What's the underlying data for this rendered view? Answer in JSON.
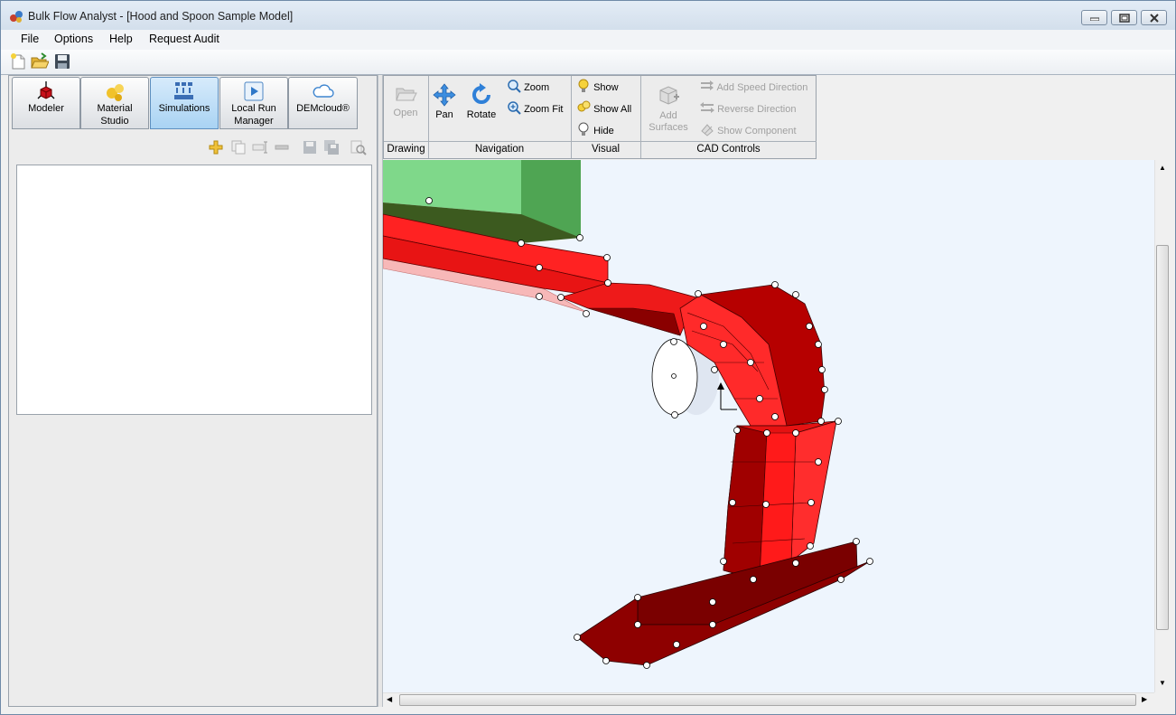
{
  "window": {
    "title": "Bulk Flow Analyst - [Hood and Spoon Sample Model]"
  },
  "menu": [
    "File",
    "Options",
    "Help",
    "Request Audit"
  ],
  "toolbar": {
    "icons": [
      "new-file-icon",
      "open-folder-icon",
      "save-icon"
    ]
  },
  "module_tabs": [
    {
      "label": "Modeler",
      "icon": "modeler-icon"
    },
    {
      "label": "Material Studio",
      "line1": "Material",
      "line2": "Studio",
      "icon": "material-icon"
    },
    {
      "label": "Simulations",
      "icon": "simulations-icon",
      "active": true
    },
    {
      "label": "Local Run Manager",
      "line1": "Local Run",
      "line2": "Manager",
      "icon": "play-icon"
    },
    {
      "label": "DEMcloud®",
      "icon": "cloud-icon"
    }
  ],
  "simulation_tools": [
    "add-icon",
    "copy-icon",
    "rename-icon",
    "remove-icon",
    "save-icon",
    "save-all-icon",
    "inspect-icon"
  ],
  "ribbon": {
    "groups": [
      {
        "caption": "Drawing",
        "buttons": [
          {
            "label": "Open",
            "enabled": false
          }
        ]
      },
      {
        "caption": "Navigation",
        "buttons": [
          {
            "label": "Pan"
          },
          {
            "label": "Rotate"
          },
          {
            "label": "Zoom"
          },
          {
            "label": "Zoom Fit"
          }
        ]
      },
      {
        "caption": "Visual",
        "buttons": [
          {
            "label": "Show"
          },
          {
            "label": "Show All"
          },
          {
            "label": "Hide"
          }
        ]
      },
      {
        "caption": "CAD Controls",
        "buttons": [
          {
            "label": "Add Surfaces",
            "line1": "Add",
            "line2": "Surfaces",
            "enabled": false
          },
          {
            "label": "Add Speed Direction",
            "enabled": false
          },
          {
            "label": "Reverse Direction",
            "enabled": false
          },
          {
            "label": "Show Component",
            "enabled": false
          }
        ]
      }
    ]
  },
  "viewport": {
    "background": "#eef5fd",
    "colors": {
      "hood": "#ff2020",
      "spoon": "#b40000",
      "hopper": "#5fc46a",
      "pulley": "#ffffff",
      "outline": "#000000"
    }
  }
}
